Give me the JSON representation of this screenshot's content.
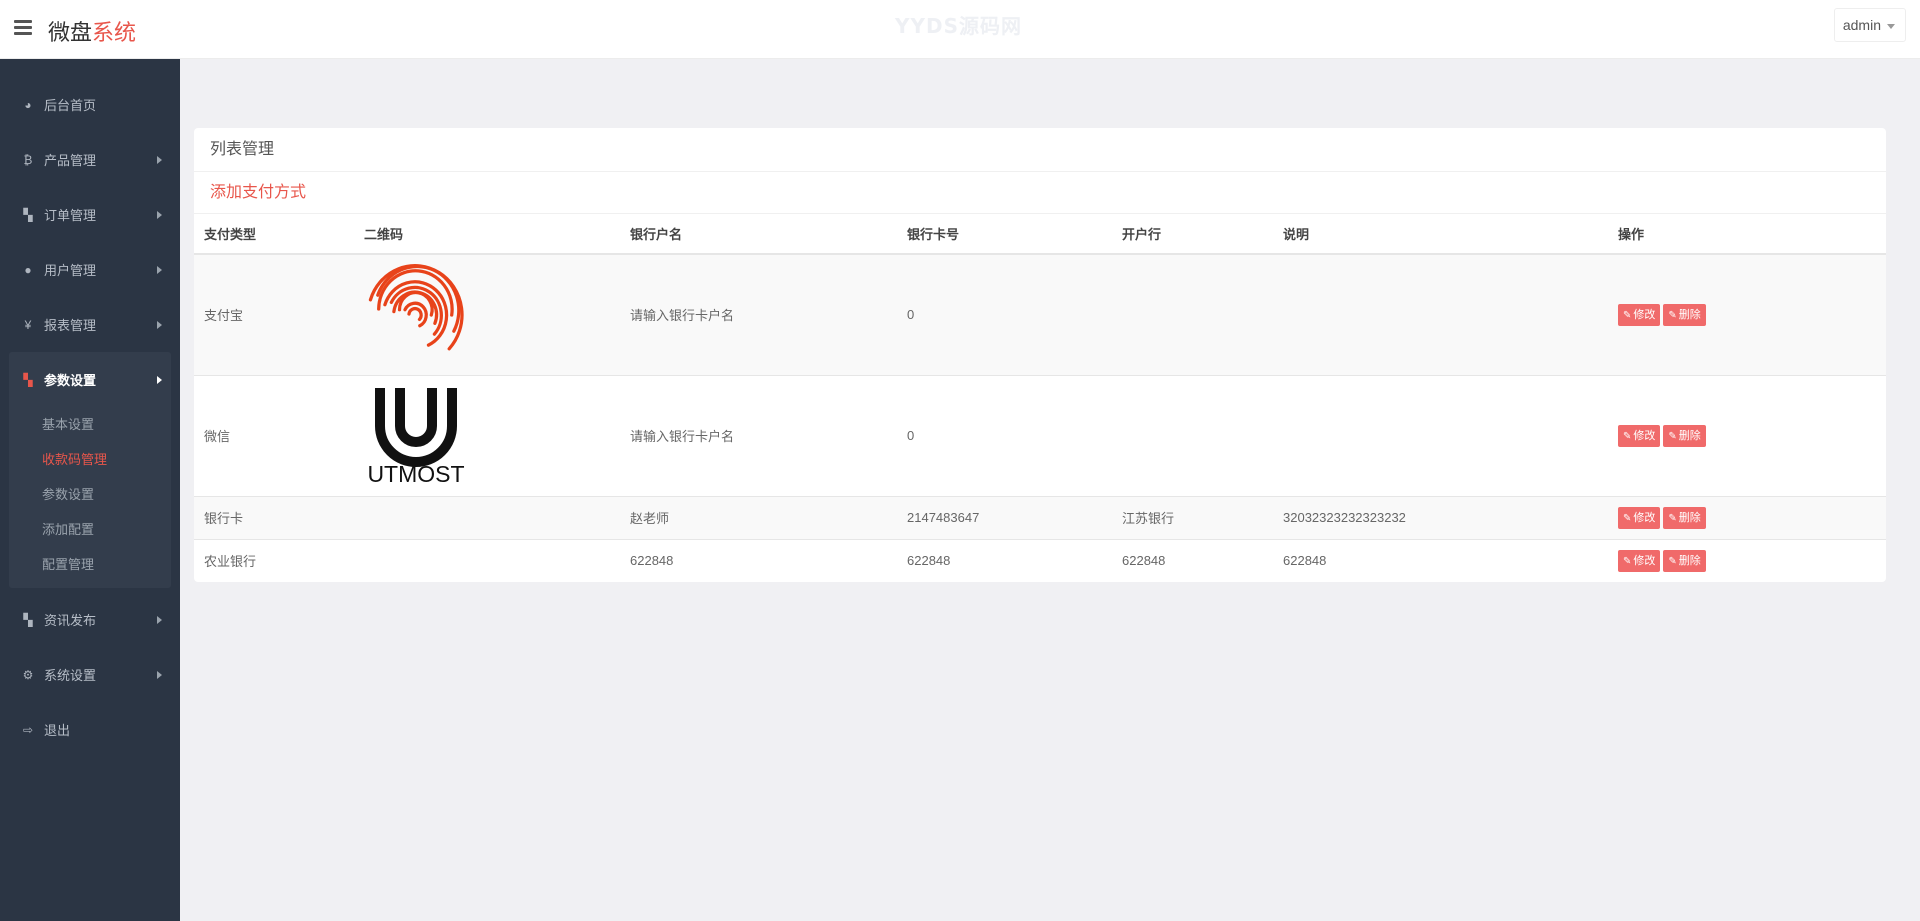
{
  "header": {
    "brand_main": "微盘",
    "brand_accent": "系统",
    "watermark": "YYDS源码网",
    "user": "admin"
  },
  "sidebar": {
    "items": [
      {
        "label": "后台首页",
        "icon": "dashboard-icon",
        "glyph": "◕"
      },
      {
        "label": "产品管理",
        "icon": "bitcoin-icon",
        "glyph": "₿"
      },
      {
        "label": "订单管理",
        "icon": "copy-icon",
        "glyph": "▚"
      },
      {
        "label": "用户管理",
        "icon": "user-icon",
        "glyph": "●"
      },
      {
        "label": "报表管理",
        "icon": "yen-icon",
        "glyph": "¥"
      }
    ],
    "active_group": {
      "label": "参数设置",
      "icon": "copy-icon",
      "glyph": "▚",
      "children": [
        "基本设置",
        "收款码管理",
        "参数设置",
        "添加配置",
        "配置管理"
      ],
      "active_child": "收款码管理"
    },
    "items_after": [
      {
        "label": "资讯发布",
        "icon": "copy-icon",
        "glyph": "▚"
      },
      {
        "label": "系统设置",
        "icon": "cogs-icon",
        "glyph": "⚙"
      },
      {
        "label": "退出",
        "icon": "sign-out-icon",
        "glyph": "⇨"
      }
    ]
  },
  "panel": {
    "title": "列表管理",
    "add_link": "添加支付方式",
    "columns": [
      "支付类型",
      "二维码",
      "银行户名",
      "银行卡号",
      "开户行",
      "说明",
      "操作"
    ],
    "rows": [
      {
        "type": "支付宝",
        "qr": "fingerprint-image",
        "account_name": "请输入银行卡户名",
        "card_no": "0",
        "bank": "",
        "note": ""
      },
      {
        "type": "微信",
        "qr": "utmost-logo-image",
        "account_name": "请输入银行卡户名",
        "card_no": "0",
        "bank": "",
        "note": ""
      },
      {
        "type": "银行卡",
        "qr": "",
        "account_name": "赵老师",
        "card_no": "2147483647",
        "bank": "江苏银行",
        "note": "32032323232323232"
      },
      {
        "type": "农业银行",
        "qr": "",
        "account_name": "622848",
        "card_no": "622848",
        "bank": "622848",
        "note": "622848"
      }
    ],
    "edit_label": "修改",
    "delete_label": "删除",
    "utmost_text": "UTMOST"
  },
  "colors": {
    "accent": "#e8564b",
    "sidebar_bg": "#2b3544",
    "button_bg": "#f06a6a"
  }
}
